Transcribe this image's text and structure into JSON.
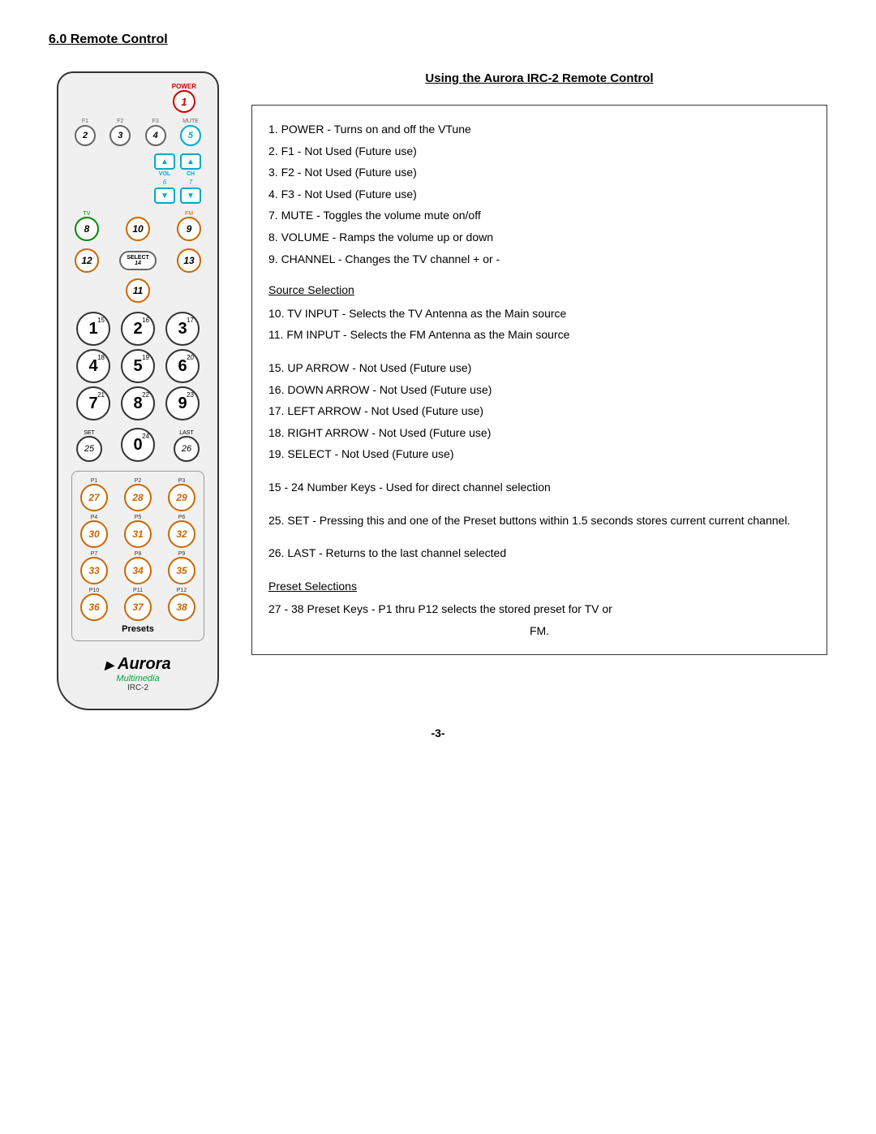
{
  "page": {
    "section_title": "6.0 Remote Control",
    "remote_title": "Using the Aurora IRC-2 Remote Control",
    "page_number": "-3-"
  },
  "remote": {
    "power_label": "POWER",
    "power_num": "1",
    "buttons": {
      "f1": {
        "label": "F1",
        "num": "2"
      },
      "f2": {
        "label": "F2",
        "num": "3"
      },
      "f3": {
        "label": "F3",
        "num": "4"
      },
      "mute": {
        "label": "MUTE",
        "num": "5"
      },
      "vol_label": "VOL",
      "vol_num": "6",
      "ch_label": "CH",
      "ch_num": "7",
      "tv": {
        "label": "TV",
        "num": "8"
      },
      "fm": {
        "label": "FM",
        "num": "9"
      },
      "n10": "10",
      "n11": "11",
      "n12": "12",
      "select": {
        "label": "SELECT",
        "num": "14"
      },
      "n13": "13",
      "n1": "1",
      "sup1": "15",
      "n2": "2",
      "sup2": "16",
      "n3": "3",
      "sup3": "17",
      "n4": "4",
      "sup4": "18",
      "n5": "5",
      "sup5": "19",
      "n6": "6",
      "sup6": "20",
      "n7": "7",
      "sup7": "21",
      "n8": "8",
      "sup8": "22",
      "n9": "9",
      "sup9": "23",
      "set": {
        "label": "SET",
        "num": "25"
      },
      "zero": {
        "num": "0",
        "sup": "24"
      },
      "last": {
        "label": "LAST",
        "num": "26"
      }
    },
    "presets": [
      {
        "label": "P1",
        "num": "27"
      },
      {
        "label": "P2",
        "num": "28"
      },
      {
        "label": "P3",
        "num": "29"
      },
      {
        "label": "P4",
        "num": "30"
      },
      {
        "label": "P5",
        "num": "31"
      },
      {
        "label": "P6",
        "num": "32"
      },
      {
        "label": "P7",
        "num": "33"
      },
      {
        "label": "P8",
        "num": "34"
      },
      {
        "label": "P9",
        "num": "35"
      },
      {
        "label": "P10",
        "num": "36"
      },
      {
        "label": "P11",
        "num": "37"
      },
      {
        "label": "P12",
        "num": "38"
      }
    ],
    "presets_title": "Presets",
    "logo_aurora": "Aurora",
    "logo_multimedia": "Multimedia",
    "model": "IRC-2"
  },
  "instructions": {
    "items": [
      "1. POWER - Turns on and off the VTune",
      "2. F1 - Not Used (Future use)",
      "3. F2 - Not Used (Future use)",
      "4. F3 - Not Used (Future use)",
      "7. MUTE - Toggles the volume mute on/off",
      "8. VOLUME - Ramps the volume up or down",
      "9. CHANNEL - Changes the TV channel + or -"
    ],
    "source_selection_title": "Source Selection",
    "source_items": [
      "10. TV INPUT - Selects the TV Antenna as the Main source",
      "11. FM INPUT - Selects the FM Antenna as the Main source"
    ],
    "arrow_items": [
      "15. UP ARROW - Not Used (Future use)",
      "16. DOWN ARROW - Not Used (Future use)",
      "17. LEFT ARROW - Not Used (Future use)",
      "18. RIGHT ARROW - Not Used (Future use)",
      "19. SELECT - Not Used (Future use)"
    ],
    "numkeys_text": "15 - 24 Number Keys - Used for direct channel selection",
    "set_text": "25. SET - Pressing this and one of the Preset buttons within 1.5 seconds stores current current channel.",
    "last_text": "26. LAST - Returns to the last channel selected",
    "preset_title": "Preset Selections",
    "preset_text": "27 - 38 Preset Keys - P1 thru P12 selects the stored preset for TV or FM."
  }
}
